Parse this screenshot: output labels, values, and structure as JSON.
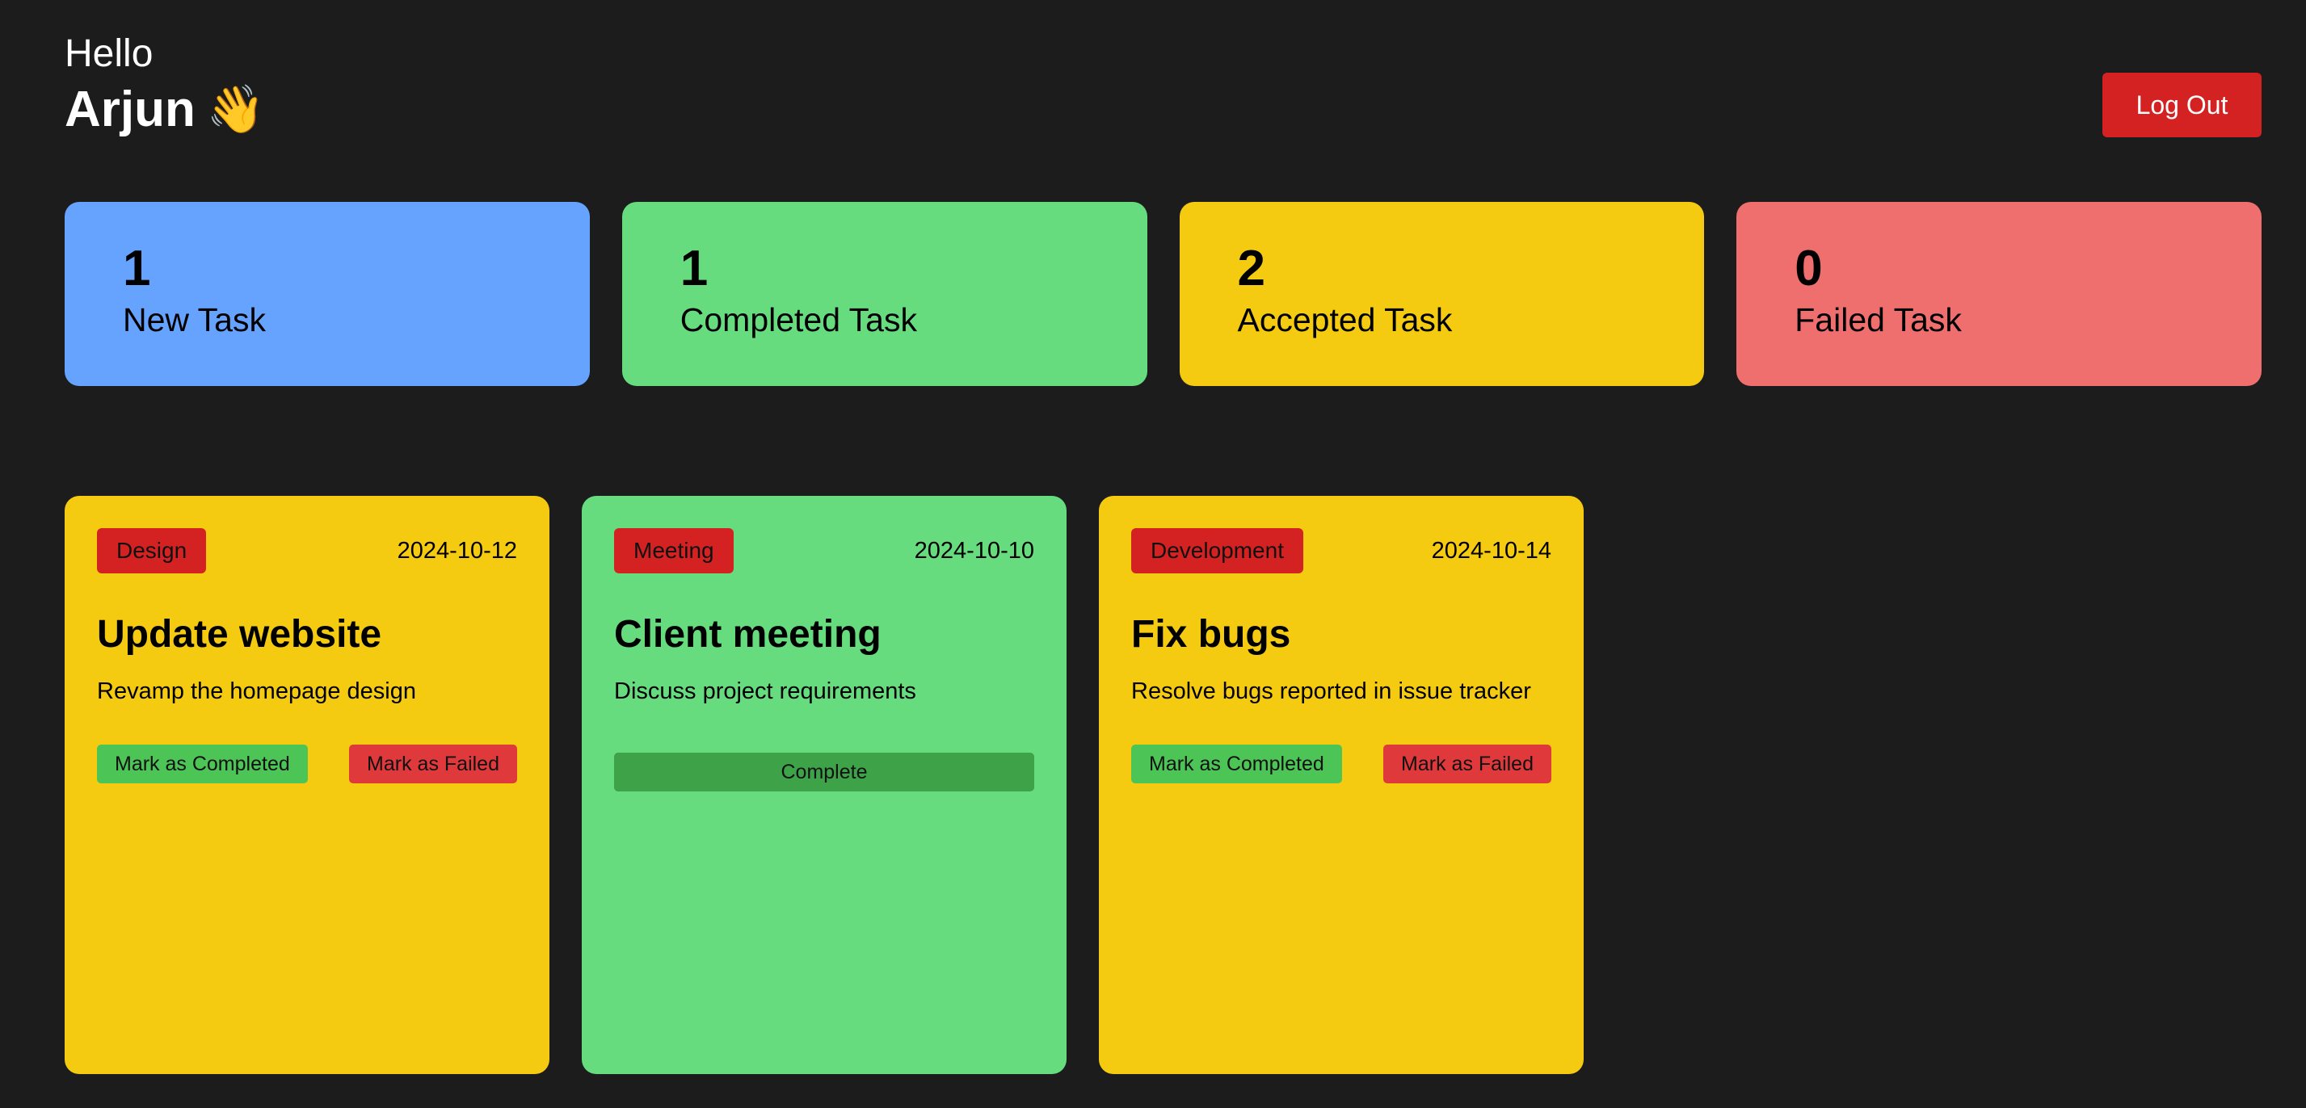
{
  "header": {
    "greeting": "Hello",
    "user_name": "Arjun",
    "wave_emoji": "👋",
    "logout_label": "Log Out"
  },
  "stats": [
    {
      "count": "1",
      "label": "New Task",
      "color": "#66a3ff"
    },
    {
      "count": "1",
      "label": "Completed Task",
      "color": "#66dc7f"
    },
    {
      "count": "2",
      "label": "Accepted Task",
      "color": "#f5cb11"
    },
    {
      "count": "0",
      "label": "Failed Task",
      "color": "#ef6e6e"
    }
  ],
  "tasks": [
    {
      "category": "Design",
      "date": "2024-10-12",
      "title": "Update website",
      "description": "Revamp the homepage design",
      "status": "accepted",
      "complete_label": "Mark as Completed",
      "failed_label": "Mark as Failed",
      "color": "#f5cb11"
    },
    {
      "category": "Meeting",
      "date": "2024-10-10",
      "title": "Client meeting",
      "description": "Discuss project requirements",
      "status": "completed",
      "status_label": "Complete",
      "color": "#66dc7f"
    },
    {
      "category": "Development",
      "date": "2024-10-14",
      "title": "Fix bugs",
      "description": "Resolve bugs reported in issue tracker",
      "status": "accepted",
      "complete_label": "Mark as Completed",
      "failed_label": "Mark as Failed",
      "color": "#f5cb11"
    }
  ]
}
